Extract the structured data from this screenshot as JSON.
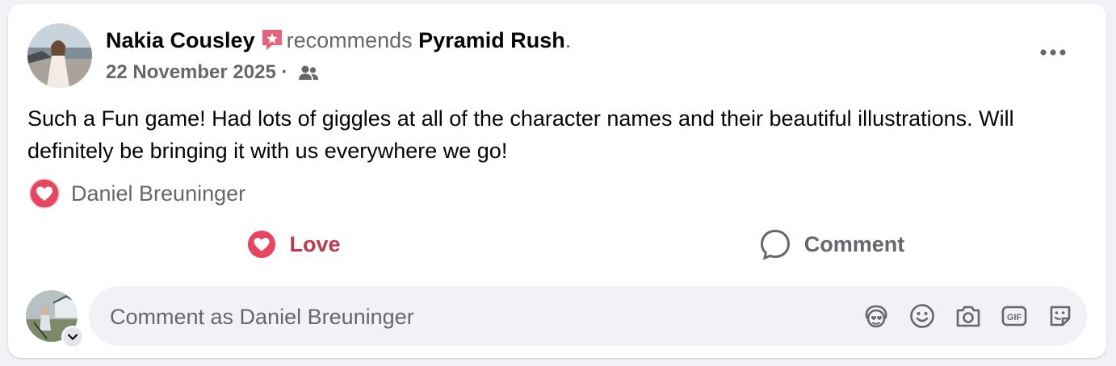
{
  "post": {
    "author": "Nakia Cousley",
    "verb": "recommends",
    "page": "Pyramid Rush",
    "period": ".",
    "date": "22 November 2025",
    "separator": "·",
    "body": "Such a Fun game! Had lots of giggles at all of the character names and their beautiful illustrations. Will definitely be bringing it with us everywhere we go!"
  },
  "reactions": {
    "icon": "love-reaction-icon",
    "names": "Daniel Breuninger"
  },
  "actions": {
    "love_label": "Love",
    "comment_label": "Comment"
  },
  "composer": {
    "placeholder": "Comment as Daniel Breuninger",
    "tools": [
      "avatar-sticker-icon",
      "emoji-icon",
      "camera-icon",
      "gif-icon",
      "sticker-icon"
    ]
  },
  "colors": {
    "love": "#c0394a",
    "recommend": "#e8637a",
    "secondary_text": "#65676b"
  }
}
